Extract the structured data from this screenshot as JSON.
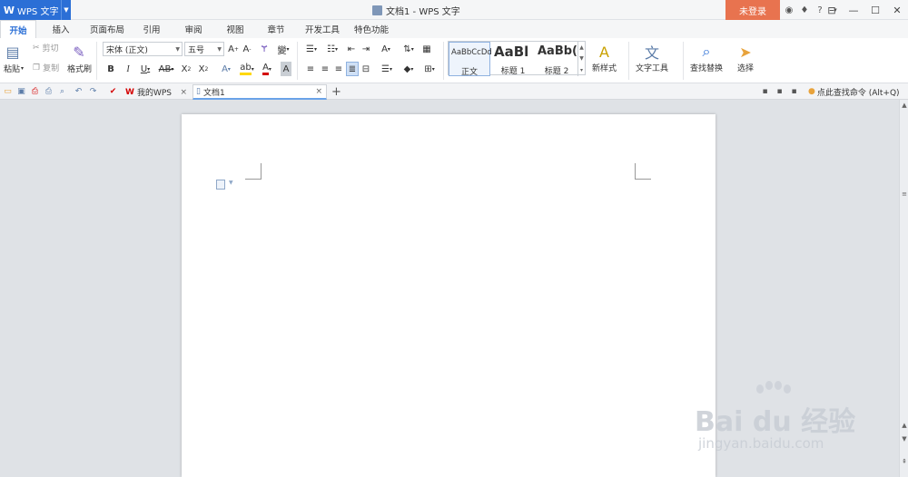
{
  "titlebar": {
    "app_name": "WPS 文字",
    "logo_glyph": "W",
    "window_title": "文档1 - WPS 文字",
    "login_label": "未登录"
  },
  "menu_tabs": [
    "开始",
    "插入",
    "页面布局",
    "引用",
    "审阅",
    "视图",
    "章节",
    "开发工具",
    "特色功能"
  ],
  "active_tab_index": 0,
  "ribbon": {
    "clipboard": {
      "paste": "粘贴",
      "cut": "剪切",
      "copy": "复制",
      "format_painter": "格式刷"
    },
    "font": {
      "name": "宋体 (正文)",
      "size": "五号"
    },
    "styles": [
      {
        "preview": "AaBbCcDd",
        "label": "正文"
      },
      {
        "preview": "AaBl",
        "label": "标题 1"
      },
      {
        "preview": "AaBb(",
        "label": "标题 2"
      }
    ],
    "new_style": "新样式",
    "text_tools": "文字工具",
    "find_replace": "查找替换",
    "select": "选择"
  },
  "doc_tabs": [
    {
      "label": "我的WPS"
    },
    {
      "label": "文档1"
    }
  ],
  "find_command": "点此查找命令 (Alt+Q)",
  "watermark": {
    "brand": "Bai du 经验",
    "url": "jingyan.baidu.com"
  },
  "colors": {
    "accent": "#2b6fd6",
    "login": "#e8734f",
    "highlight": "#ffd800",
    "font_color": "#d40000"
  }
}
